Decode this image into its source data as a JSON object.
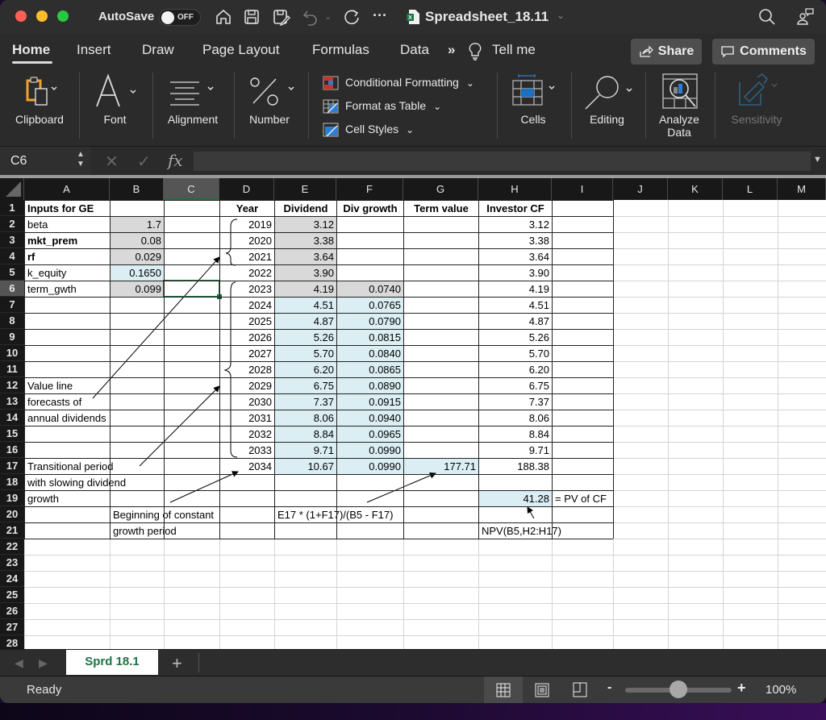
{
  "titlebar": {
    "autosave_label": "AutoSave",
    "autosave_state": "OFF",
    "file_name": "Spreadsheet_18.11"
  },
  "tabs": [
    {
      "label": "Home",
      "active": true
    },
    {
      "label": "Insert"
    },
    {
      "label": "Draw"
    },
    {
      "label": "Page Layout"
    },
    {
      "label": "Formulas"
    },
    {
      "label": "Data"
    },
    {
      "label": "Tell me"
    }
  ],
  "header_buttons": {
    "share": "Share",
    "comments": "Comments"
  },
  "ribbon": {
    "clipboard": "Clipboard",
    "font": "Font",
    "alignment": "Alignment",
    "number": "Number",
    "conditional_formatting": "Conditional Formatting",
    "format_as_table": "Format as Table",
    "cell_styles": "Cell Styles",
    "cells": "Cells",
    "editing": "Editing",
    "analyze_data_1": "Analyze",
    "analyze_data_2": "Data",
    "sensitivity": "Sensitivity"
  },
  "formula_bar": {
    "name_box": "C6",
    "fx": "fx",
    "formula": ""
  },
  "columns": [
    "A",
    "B",
    "C",
    "D",
    "E",
    "F",
    "G",
    "H",
    "I",
    "J",
    "K",
    "L",
    "M"
  ],
  "selected_column": "C",
  "selected_row": 6,
  "rows": [
    "1",
    "2",
    "3",
    "4",
    "5",
    "6",
    "7",
    "8",
    "9",
    "10",
    "11",
    "12",
    "13",
    "14",
    "15",
    "16",
    "17",
    "18",
    "19",
    "20",
    "21",
    "22",
    "23",
    "24",
    "25",
    "26",
    "27",
    "28"
  ],
  "sheet": {
    "A1": "Inputs for GE",
    "A2": "beta",
    "B2": "1.7",
    "A3": "mkt_prem",
    "B3": "0.08",
    "A4": "rf",
    "B4": "0.029",
    "A5": "k_equity",
    "B5": "0.1650",
    "A6": "term_gwth",
    "B6": "0.099",
    "D1": "Year",
    "E1": "Dividend",
    "F1": "Div growth",
    "G1": "Term value",
    "H1": "Investor CF",
    "years": [
      "2019",
      "2020",
      "2021",
      "2022",
      "2023",
      "2024",
      "2025",
      "2026",
      "2027",
      "2028",
      "2029",
      "2030",
      "2031",
      "2032",
      "2033",
      "2034"
    ],
    "dividends": [
      "3.12",
      "3.38",
      "3.64",
      "3.90",
      "4.19",
      "4.51",
      "4.87",
      "5.26",
      "5.70",
      "6.20",
      "6.75",
      "7.37",
      "8.06",
      "8.84",
      "9.71",
      "10.67"
    ],
    "div_growth": [
      "",
      "",
      "",
      "",
      "0.0740",
      "0.0765",
      "0.0790",
      "0.0815",
      "0.0840",
      "0.0865",
      "0.0890",
      "0.0915",
      "0.0940",
      "0.0965",
      "0.0990",
      "0.0990"
    ],
    "investor_cf": [
      "3.12",
      "3.38",
      "3.64",
      "3.90",
      "4.19",
      "4.51",
      "4.87",
      "5.26",
      "5.70",
      "6.20",
      "6.75",
      "7.37",
      "8.06",
      "8.84",
      "9.71",
      "188.38"
    ],
    "G17": "177.71",
    "A12": "Value line",
    "A13": "forecasts of",
    "A14": "annual dividends",
    "A17": "Transitional period",
    "A18": "with slowing dividend",
    "A19": "growth",
    "B20": "Beginning of constant",
    "B21": "growth period",
    "E20": "E17 * (1+F17)/(B5 - F17)",
    "H19": "41.28",
    "I19": "= PV of CF",
    "H21": "NPV(B5,H2:H17)"
  },
  "sheet_tabs": [
    {
      "label": "Sprd 18.1",
      "active": true
    }
  ],
  "status": {
    "text": "Ready",
    "zoom": "100%",
    "zoom_slider_percent": 50
  },
  "colors": {
    "excel_green": "#1e7145",
    "input_gray": "#d9d9d9",
    "calc_blue": "#dbeef4"
  }
}
